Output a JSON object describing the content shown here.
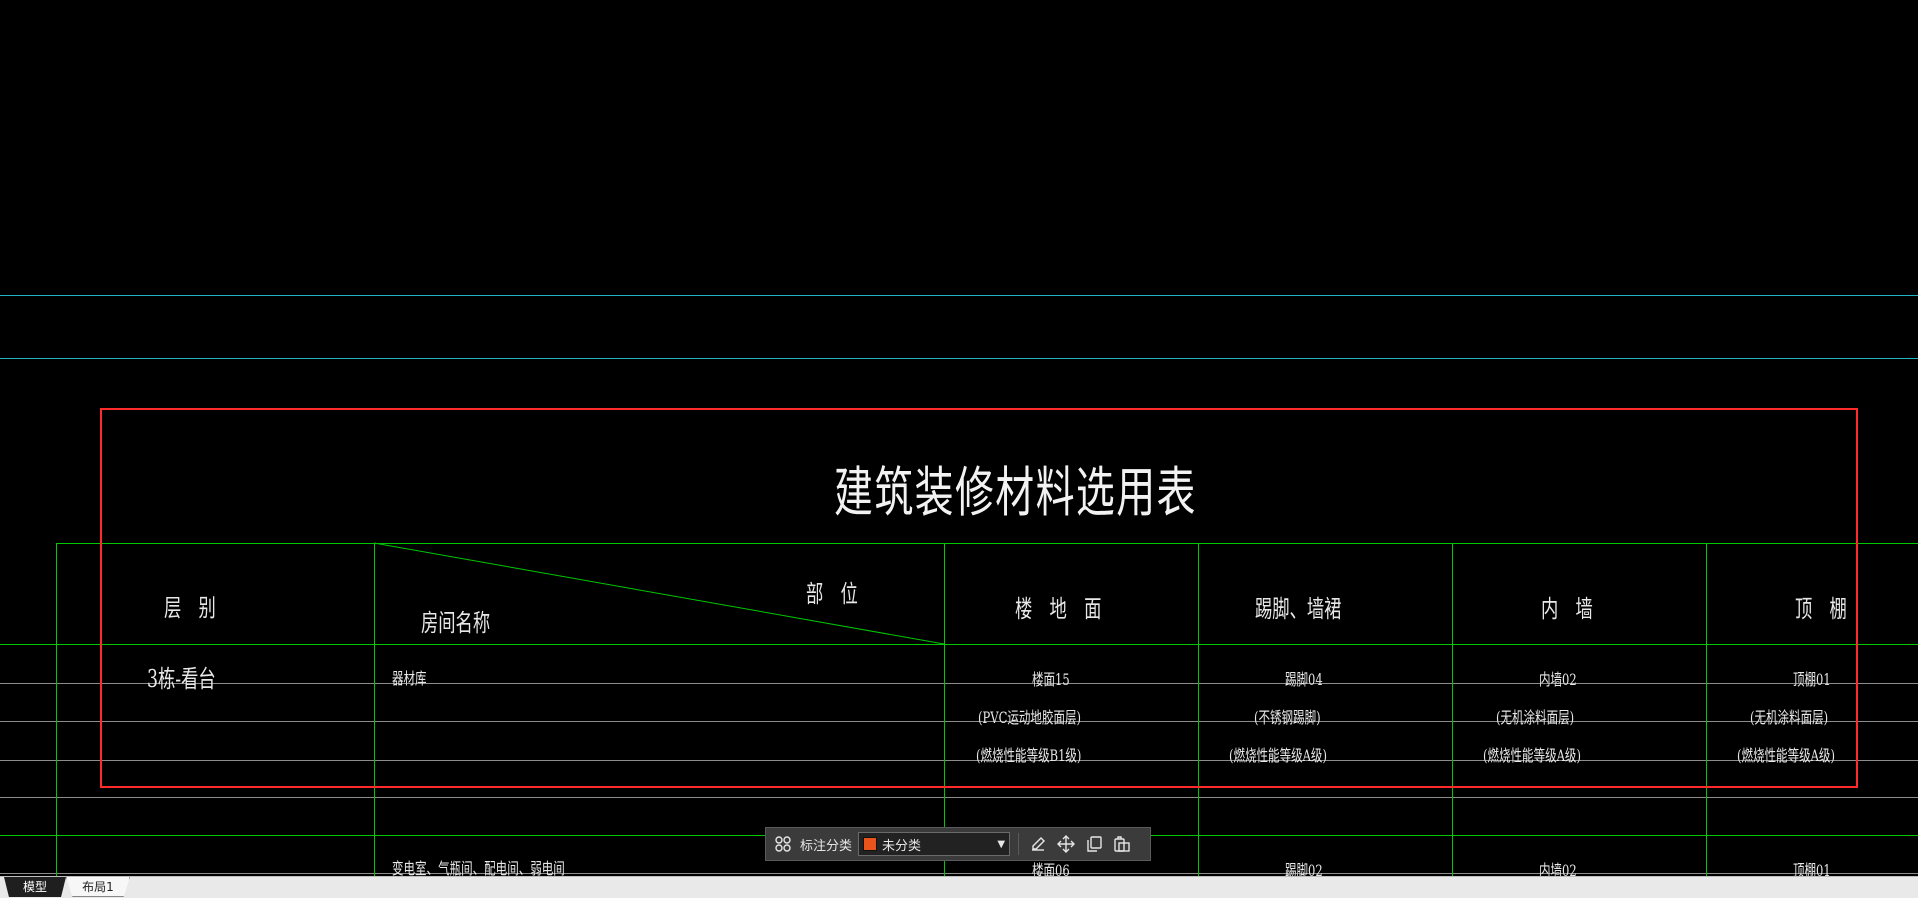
{
  "drawing": {
    "title": "建筑装修材料选用表",
    "headers": {
      "level": "层　别",
      "position": "部　位",
      "room_name": "房间名称",
      "floor": "楼　地　面",
      "baseboard": "踢脚、墙裙",
      "inner_wall": "内　墙",
      "ceiling": "顶　棚"
    },
    "rows": [
      {
        "level": "3栋-看台",
        "room": "器材库",
        "floor": [
          "楼面15",
          "(PVC运动地胶面层)",
          "(燃烧性能等级B1级)"
        ],
        "baseboard": [
          "踢脚04",
          "(不锈钢踢脚)",
          "(燃烧性能等级A级)"
        ],
        "inner_wall": [
          "内墙02",
          "(无机涂料面层)",
          "(燃烧性能等级A级)"
        ],
        "ceiling": [
          "顶棚01",
          "(无机涂料面层)",
          "(燃烧性能等级A级)"
        ]
      },
      {
        "level": "",
        "room": "变电室、气瓶间、配电间、弱电间",
        "floor": [
          "楼面06"
        ],
        "baseboard": [
          "踢脚02"
        ],
        "inner_wall": [
          "内墙02"
        ],
        "ceiling": [
          "顶棚01"
        ]
      }
    ]
  },
  "toolbar": {
    "category_label": "标注分类",
    "category_value": "未分类",
    "category_color": "#e8541c",
    "icons": [
      "grid-icon",
      "edit-icon",
      "move-icon",
      "copy-icon",
      "paste-icon"
    ]
  },
  "tabs": [
    {
      "label": "模型",
      "active": true
    },
    {
      "label": "布局1",
      "active": false
    }
  ],
  "colors": {
    "background": "#000000",
    "table_lines": "#00c800",
    "gray_lines": "#8c8c8c",
    "cyan_lines": "#1fb3c4",
    "selection": "#ff2a2a",
    "text": "#e8e8e8"
  }
}
